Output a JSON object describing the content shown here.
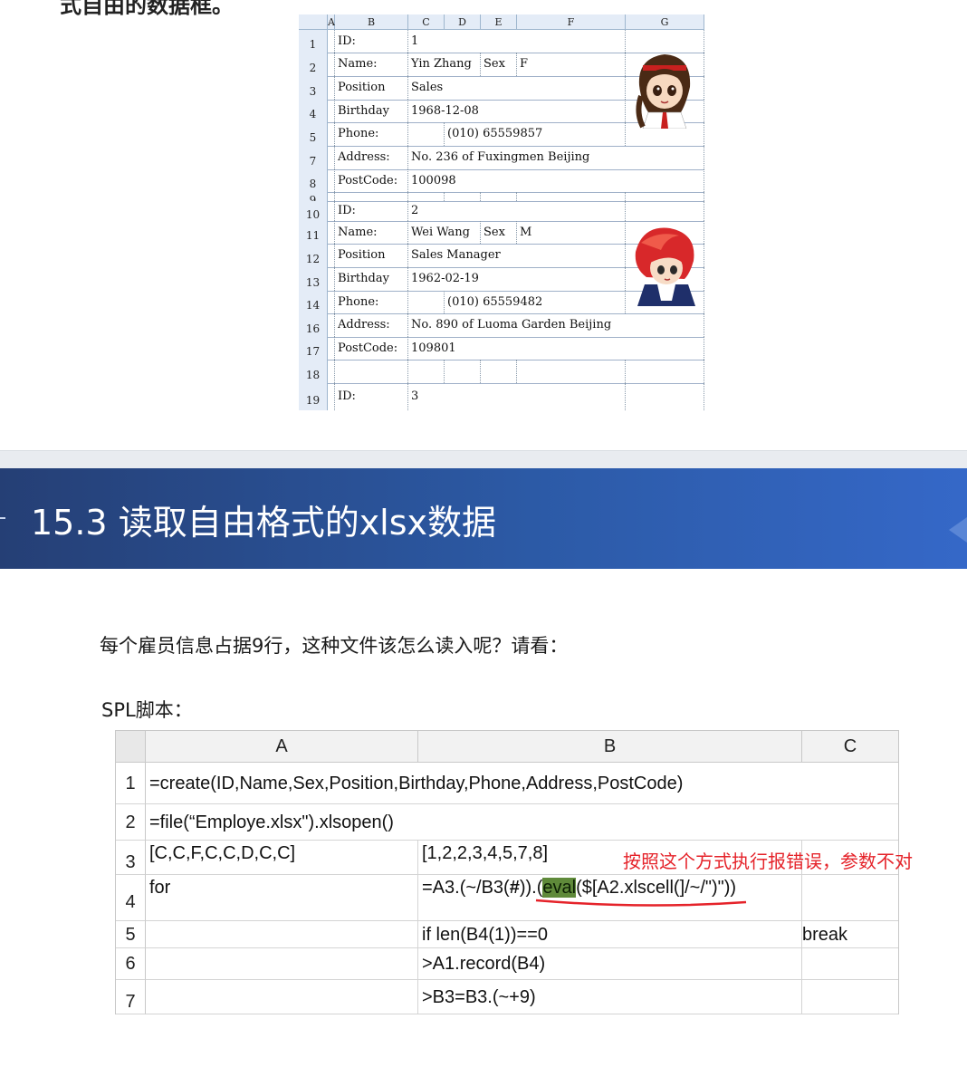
{
  "top_text": "式自由的数据框。",
  "excel": {
    "col_headers": [
      "A",
      "B",
      "C",
      "D",
      "E",
      "F",
      "G"
    ],
    "rows": [
      {
        "num": "1",
        "label": "ID:",
        "v1": "1"
      },
      {
        "num": "2",
        "label": "Name:",
        "v1": "Yin Zhang",
        "k2": "Sex",
        "v2": "F"
      },
      {
        "num": "3",
        "label": "Position",
        "v1": "Sales"
      },
      {
        "num": "4",
        "label": "Birthday",
        "v1": "1968-12-08"
      },
      {
        "num": "5",
        "label": "Phone:",
        "v1": "(010) 65559857"
      },
      {
        "num": "7",
        "label": "Address:",
        "v1": "No. 236 of Fuxingmen Beijing"
      },
      {
        "num": "8",
        "label": "PostCode:",
        "v1": "100098"
      },
      {
        "num": "9",
        "label": "",
        "v1": ""
      },
      {
        "num": "10",
        "label": "ID:",
        "v1": "2"
      },
      {
        "num": "11",
        "label": "Name:",
        "v1": "Wei Wang",
        "k2": "Sex",
        "v2": "M"
      },
      {
        "num": "12",
        "label": "Position",
        "v1": "Sales Manager"
      },
      {
        "num": "13",
        "label": "Birthday",
        "v1": "1962-02-19"
      },
      {
        "num": "14",
        "label": "Phone:",
        "v1": "(010) 65559482"
      },
      {
        "num": "16",
        "label": "Address:",
        "v1": "No. 890 of Luoma Garden Beijing"
      },
      {
        "num": "17",
        "label": "PostCode:",
        "v1": "109801"
      },
      {
        "num": "18",
        "label": "",
        "v1": ""
      },
      {
        "num": "19",
        "label": "ID:",
        "v1": "3"
      }
    ]
  },
  "banner": {
    "title": "15.3  读取自由格式的xlsx数据"
  },
  "para": "每个雇员信息占据9行，这种文件该怎么读入呢？请看：",
  "spl_label": "SPL脚本：",
  "grid": {
    "col_headers": [
      "A",
      "B",
      "C"
    ],
    "rows": [
      {
        "num": "1",
        "a": "=create(ID,Name,Sex,Position,Birthday,Phone,Address,PostCode)",
        "b": "",
        "c": ""
      },
      {
        "num": "2",
        "a": "=file(“Employe.xlsx\").xlsopen()",
        "b": "",
        "c": ""
      },
      {
        "num": "3",
        "a": "[C,C,F,C,C,D,C,C]",
        "b": "[1,2,2,3,4,5,7,8]",
        "c": ""
      },
      {
        "num": "4",
        "a": "for",
        "b_pre": "=A3.(~/B3(",
        "b_bold": "#",
        "b_mid": ")).(",
        "b_hl": "eval",
        "b_post": "($[A2.xlscell(]/~/\")\"))",
        "c": ""
      },
      {
        "num": "5",
        "a": "",
        "b": "if len(B4(1))==0",
        "c": "break"
      },
      {
        "num": "6",
        "a": "",
        "b": ">A1.record(B4)",
        "c": ""
      },
      {
        "num": "7",
        "a": "",
        "b": ">B3=B3.(~+9)",
        "c": ""
      }
    ]
  },
  "annotation": "按照这个方式执行报错误，参数不对",
  "colors": {
    "banner": "#2c5aa6",
    "annotation": "#e5232a",
    "highlight": "#5f8a3a"
  }
}
